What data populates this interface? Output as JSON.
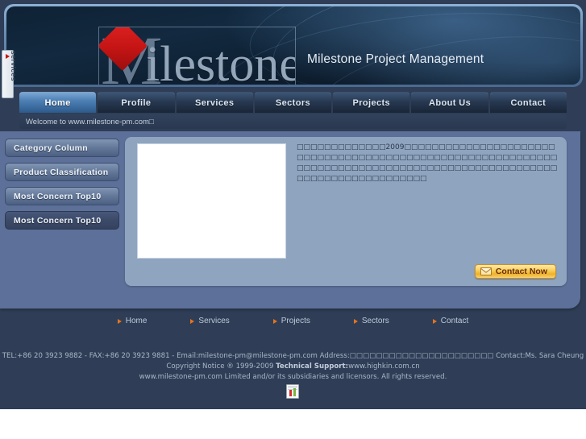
{
  "site": {
    "brand_mark_letter": "M",
    "brand_mark_rest": "ilestone",
    "brand_title": "Milestone Project Management"
  },
  "side_tab": {
    "label": "services"
  },
  "nav": {
    "items": [
      {
        "label": "Home",
        "active": true
      },
      {
        "label": "Profile",
        "active": false
      },
      {
        "label": "Services",
        "active": false
      },
      {
        "label": "Sectors",
        "active": false
      },
      {
        "label": "Projects",
        "active": false
      },
      {
        "label": "About Us",
        "active": false
      },
      {
        "label": "Contact",
        "active": false
      }
    ]
  },
  "welcome": {
    "text": "Welcome to www.milestone-pm.com□"
  },
  "sidebar": {
    "buttons": [
      {
        "label": "Category Column",
        "style": "light"
      },
      {
        "label": "Product Classification",
        "style": "light"
      },
      {
        "label": "Most Concern Top10",
        "style": "light"
      },
      {
        "label": "Most Concern Top10",
        "style": "dark"
      }
    ]
  },
  "content": {
    "image_alt": "",
    "article": "□□□□□□□□□□□□□2009□□□□□□□□□□□□□□□□□□□□□□□□□□□□□□□□□□□□□□□□□□□□□□□□□□□□□□□□□□□□□□□□□□□□□□□□□□□□□□□□□□□□□□□□□□□□□□□□□□□□□□□□□□□□□□□□□□□□□",
    "contact_button": "Contact Now",
    "contact_icon": "envelope-icon"
  },
  "footer_nav": {
    "items": [
      {
        "label": "Home"
      },
      {
        "label": "Services"
      },
      {
        "label": "Projects"
      },
      {
        "label": "Sectors"
      },
      {
        "label": "Contact"
      }
    ]
  },
  "footer": {
    "line1_a": "TEL:+86 20 3923 9882 - FAX:+86 20 3923 9881 - Email:milestone-pm@milestone-pm.com   Address:",
    "line1_cn": "□□□□□□□□□□□□□□□□□□□□□□",
    "line1_b": "   Contact:Ms. Sara Cheung",
    "line2_a": "Copyright Notice ® 1999-2009   ",
    "line2_bold": "Technical Support:",
    "line2_b": "www.highkin.com.cn",
    "line3": "www.milestone-pm.com Limited and/or its subsidiaries and licensors. All rights reserved."
  },
  "bottom_icon": {
    "name": "broken-image-chart-icon"
  }
}
